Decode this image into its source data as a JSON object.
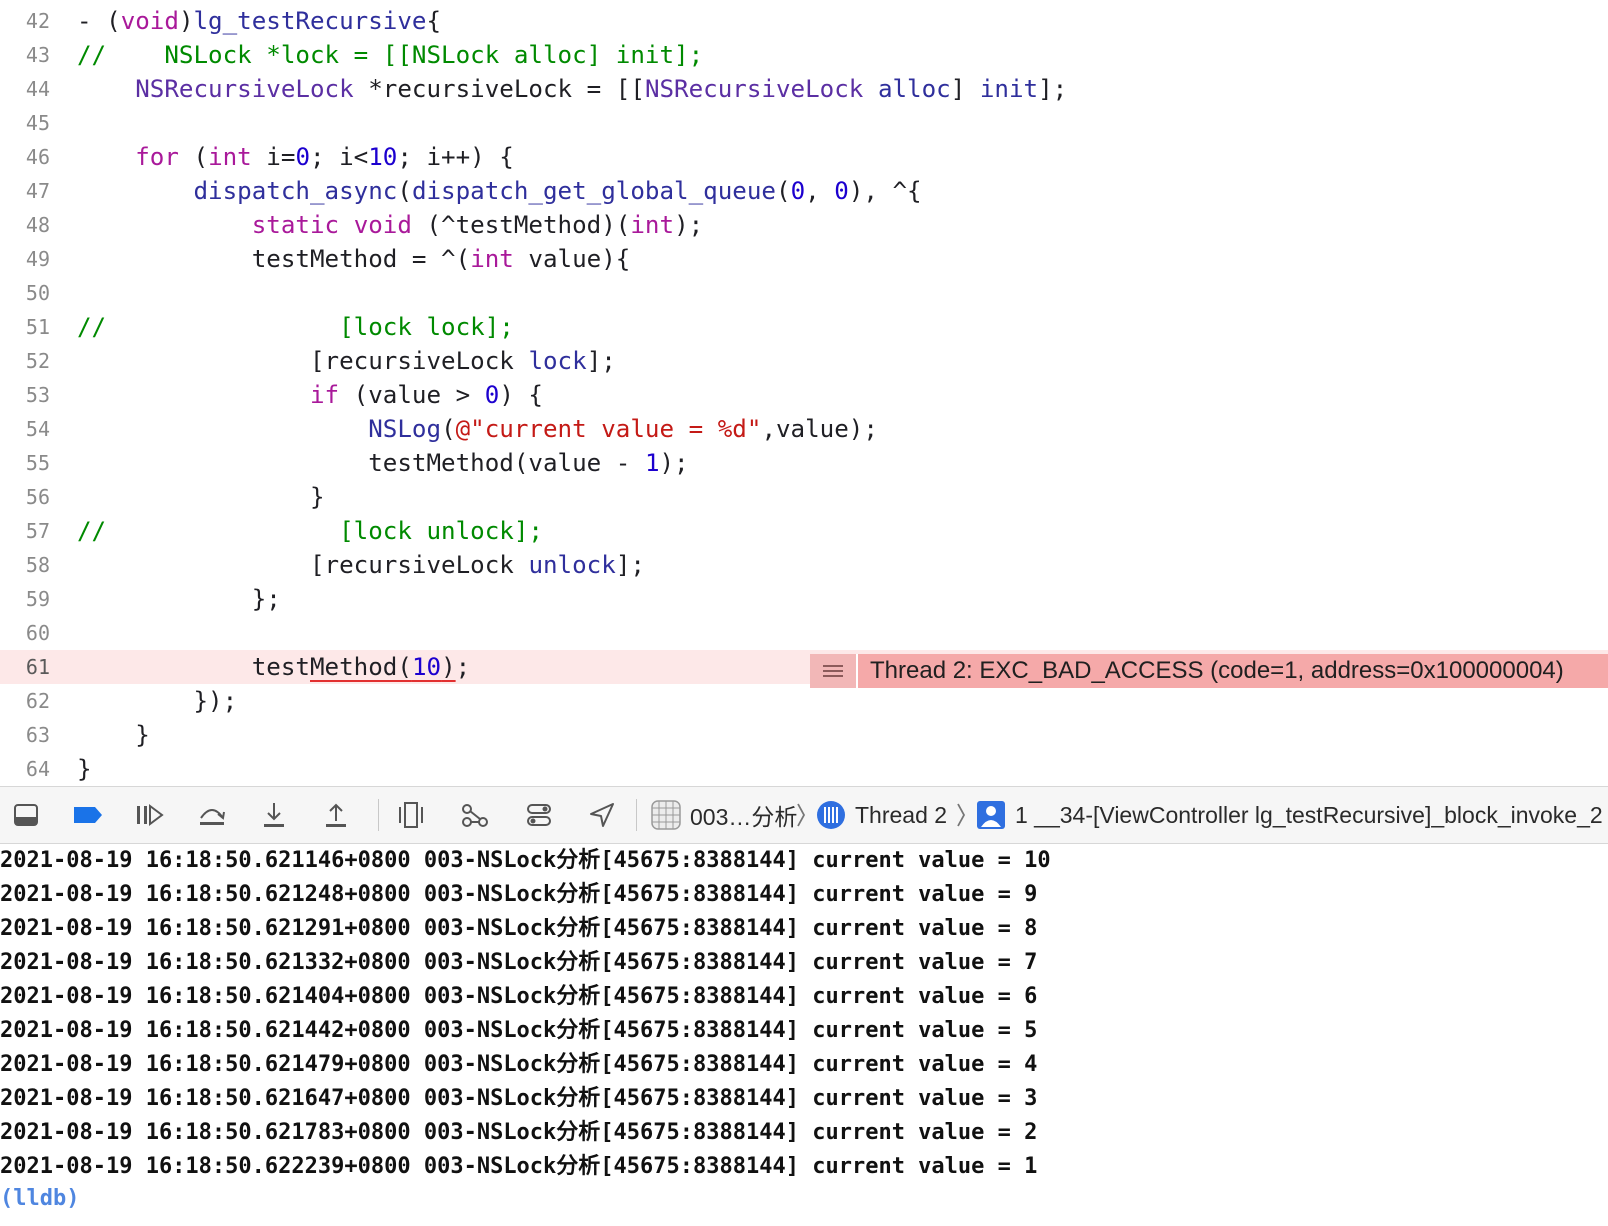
{
  "editor": {
    "lines": [
      {
        "number": "42",
        "tokens": [
          {
            "t": "- (",
            "c": "pl"
          },
          {
            "t": "void",
            "c": "kw"
          },
          {
            "t": ")",
            "c": "pl"
          },
          {
            "t": "lg_testRecursive",
            "c": "fn"
          },
          {
            "t": "{",
            "c": "pl"
          }
        ]
      },
      {
        "number": "43",
        "tokens": [
          {
            "t": "//    NSLock *lock = [[NSLock alloc] init];",
            "c": "cm"
          }
        ]
      },
      {
        "number": "44",
        "tokens": [
          {
            "t": "    ",
            "c": "pl"
          },
          {
            "t": "NSRecursiveLock",
            "c": "ty"
          },
          {
            "t": " *recursiveLock = [[",
            "c": "pl"
          },
          {
            "t": "NSRecursiveLock",
            "c": "ty"
          },
          {
            "t": " ",
            "c": "pl"
          },
          {
            "t": "alloc",
            "c": "fn"
          },
          {
            "t": "] ",
            "c": "pl"
          },
          {
            "t": "init",
            "c": "fn"
          },
          {
            "t": "];",
            "c": "pl"
          }
        ]
      },
      {
        "number": "45",
        "tokens": []
      },
      {
        "number": "46",
        "tokens": [
          {
            "t": "    ",
            "c": "pl"
          },
          {
            "t": "for",
            "c": "kw"
          },
          {
            "t": " (",
            "c": "pl"
          },
          {
            "t": "int",
            "c": "kw"
          },
          {
            "t": " i=",
            "c": "pl"
          },
          {
            "t": "0",
            "c": "nu"
          },
          {
            "t": "; i<",
            "c": "pl"
          },
          {
            "t": "10",
            "c": "nu"
          },
          {
            "t": "; i++) {",
            "c": "pl"
          }
        ]
      },
      {
        "number": "47",
        "tokens": [
          {
            "t": "        ",
            "c": "pl"
          },
          {
            "t": "dispatch_async",
            "c": "fn"
          },
          {
            "t": "(",
            "c": "pl"
          },
          {
            "t": "dispatch_get_global_queue",
            "c": "fn"
          },
          {
            "t": "(",
            "c": "pl"
          },
          {
            "t": "0",
            "c": "nu"
          },
          {
            "t": ", ",
            "c": "pl"
          },
          {
            "t": "0",
            "c": "nu"
          },
          {
            "t": "), ^{",
            "c": "pl"
          }
        ]
      },
      {
        "number": "48",
        "tokens": [
          {
            "t": "            ",
            "c": "pl"
          },
          {
            "t": "static",
            "c": "kw"
          },
          {
            "t": " ",
            "c": "pl"
          },
          {
            "t": "void",
            "c": "kw"
          },
          {
            "t": " (^testMethod)(",
            "c": "pl"
          },
          {
            "t": "int",
            "c": "kw"
          },
          {
            "t": ");",
            "c": "pl"
          }
        ]
      },
      {
        "number": "49",
        "tokens": [
          {
            "t": "            testMethod = ^(",
            "c": "pl"
          },
          {
            "t": "int",
            "c": "kw"
          },
          {
            "t": " value){",
            "c": "pl"
          }
        ]
      },
      {
        "number": "50",
        "tokens": []
      },
      {
        "number": "51",
        "tokens": [
          {
            "t": "//                [lock lock];",
            "c": "cm"
          }
        ]
      },
      {
        "number": "52",
        "tokens": [
          {
            "t": "                [recursiveLock ",
            "c": "pl"
          },
          {
            "t": "lock",
            "c": "fn"
          },
          {
            "t": "];",
            "c": "pl"
          }
        ]
      },
      {
        "number": "53",
        "tokens": [
          {
            "t": "                ",
            "c": "pl"
          },
          {
            "t": "if",
            "c": "kw"
          },
          {
            "t": " (value > ",
            "c": "pl"
          },
          {
            "t": "0",
            "c": "nu"
          },
          {
            "t": ") {",
            "c": "pl"
          }
        ]
      },
      {
        "number": "54",
        "tokens": [
          {
            "t": "                    ",
            "c": "pl"
          },
          {
            "t": "NSLog",
            "c": "fn"
          },
          {
            "t": "(",
            "c": "pl"
          },
          {
            "t": "@\"current value = %d\"",
            "c": "st"
          },
          {
            "t": ",value);",
            "c": "pl"
          }
        ]
      },
      {
        "number": "55",
        "tokens": [
          {
            "t": "                    testMethod(value - ",
            "c": "pl"
          },
          {
            "t": "1",
            "c": "nu"
          },
          {
            "t": ");",
            "c": "pl"
          }
        ]
      },
      {
        "number": "56",
        "tokens": [
          {
            "t": "                }",
            "c": "pl"
          }
        ]
      },
      {
        "number": "57",
        "tokens": [
          {
            "t": "//                [lock unlock];",
            "c": "cm"
          }
        ]
      },
      {
        "number": "58",
        "tokens": [
          {
            "t": "                [recursiveLock ",
            "c": "pl"
          },
          {
            "t": "unlock",
            "c": "fn"
          },
          {
            "t": "];",
            "c": "pl"
          }
        ]
      },
      {
        "number": "59",
        "tokens": [
          {
            "t": "            };",
            "c": "pl"
          }
        ]
      },
      {
        "number": "60",
        "tokens": []
      },
      {
        "number": "61",
        "error": true,
        "tokens": [
          {
            "t": "            test",
            "c": "pl"
          },
          {
            "t": "Method(",
            "c": "pl",
            "u": true
          },
          {
            "t": "10",
            "c": "nu",
            "u": true
          },
          {
            "t": ")",
            "c": "pl",
            "u": true
          },
          {
            "t": ";",
            "c": "pl"
          }
        ]
      },
      {
        "number": "62",
        "tokens": [
          {
            "t": "        });",
            "c": "pl"
          }
        ]
      },
      {
        "number": "63",
        "tokens": [
          {
            "t": "    }",
            "c": "pl"
          }
        ]
      },
      {
        "number": "64",
        "tokens": [
          {
            "t": "}",
            "c": "pl"
          }
        ]
      }
    ],
    "error_annotation": {
      "icon": "list-icon",
      "message": "Thread 2: EXC_BAD_ACCESS (code=1, address=0x100000004)"
    }
  },
  "debug_bar": {
    "buttons": [
      {
        "name": "hide-debug-area-button",
        "icon": "panel-bottom-icon"
      },
      {
        "name": "breakpoints-toggle-button",
        "icon": "breakpoint-icon"
      },
      {
        "name": "continue-button",
        "icon": "continue-icon"
      },
      {
        "name": "step-over-button",
        "icon": "step-over-icon"
      },
      {
        "name": "step-into-button",
        "icon": "step-into-icon"
      },
      {
        "name": "step-out-button",
        "icon": "step-out-icon"
      },
      {
        "name": "view-hierarchy-button",
        "icon": "view-hierarchy-icon"
      },
      {
        "name": "memory-graph-button",
        "icon": "memory-graph-icon"
      },
      {
        "name": "environment-overrides-button",
        "icon": "environment-overrides-icon"
      },
      {
        "name": "simulate-location-button",
        "icon": "location-icon"
      }
    ],
    "breadcrumbs": {
      "process": "003…分析",
      "thread": "Thread 2",
      "frame": "1 __34-[ViewController lg_testRecursive]_block_invoke_2"
    }
  },
  "console": {
    "lines": [
      "2021-08-19 16:18:50.621146+0800 003-NSLock分析[45675:8388144] current value = 10",
      "2021-08-19 16:18:50.621248+0800 003-NSLock分析[45675:8388144] current value = 9",
      "2021-08-19 16:18:50.621291+0800 003-NSLock分析[45675:8388144] current value = 8",
      "2021-08-19 16:18:50.621332+0800 003-NSLock分析[45675:8388144] current value = 7",
      "2021-08-19 16:18:50.621404+0800 003-NSLock分析[45675:8388144] current value = 6",
      "2021-08-19 16:18:50.621442+0800 003-NSLock分析[45675:8388144] current value = 5",
      "2021-08-19 16:18:50.621479+0800 003-NSLock分析[45675:8388144] current value = 4",
      "2021-08-19 16:18:50.621647+0800 003-NSLock分析[45675:8388144] current value = 3",
      "2021-08-19 16:18:50.621783+0800 003-NSLock分析[45675:8388144] current value = 2",
      "2021-08-19 16:18:50.622239+0800 003-NSLock分析[45675:8388144] current value = 1"
    ],
    "prompt": "(lldb)"
  },
  "colors": {
    "comment": "#008a00",
    "keyword": "#a9199a",
    "type": "#5b2fa3",
    "function": "#2f2f9c",
    "number": "#1c00cf",
    "string": "#c41a16",
    "error_line_bg": "#fde8e8",
    "error_banner_bg": "#f5a9a9",
    "lldb_prompt": "#4f86e0",
    "breakpoint_blue": "#1a73e8"
  }
}
